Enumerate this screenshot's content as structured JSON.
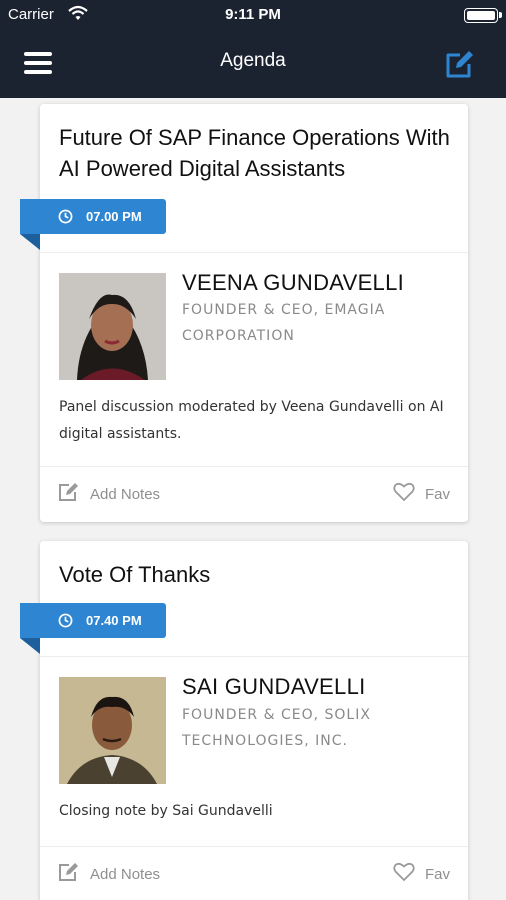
{
  "status_bar": {
    "carrier": "Carrier",
    "time": "9:11 PM"
  },
  "nav": {
    "title": "Agenda",
    "menu_icon": "hamburger-menu-icon",
    "edit_icon": "edit-square-icon"
  },
  "colors": {
    "nav_bg": "#1b2230",
    "accent": "#2e86d2",
    "accent_dark": "#1d5f9d",
    "muted": "#8f8f8f"
  },
  "sessions": [
    {
      "title": "Future Of SAP Finance Operations With AI Powered Digital Assistants",
      "time": "07.00 PM",
      "speaker": {
        "name": "VEENA GUNDAVELLI",
        "role": "FOUNDER & CEO, EMAGIA CORPORATION"
      },
      "description": "Panel discussion moderated by Veena Gundavelli on AI digital assistants.",
      "notes_label": "Add Notes",
      "fav_label": "Fav"
    },
    {
      "title": "Vote Of Thanks",
      "time": "07.40 PM",
      "speaker": {
        "name": "SAI GUNDAVELLI",
        "role": "FOUNDER & CEO, SOLIX TECHNOLOGIES, INC."
      },
      "description": "Closing note by Sai Gundavelli",
      "notes_label": "Add Notes",
      "fav_label": "Fav"
    }
  ]
}
